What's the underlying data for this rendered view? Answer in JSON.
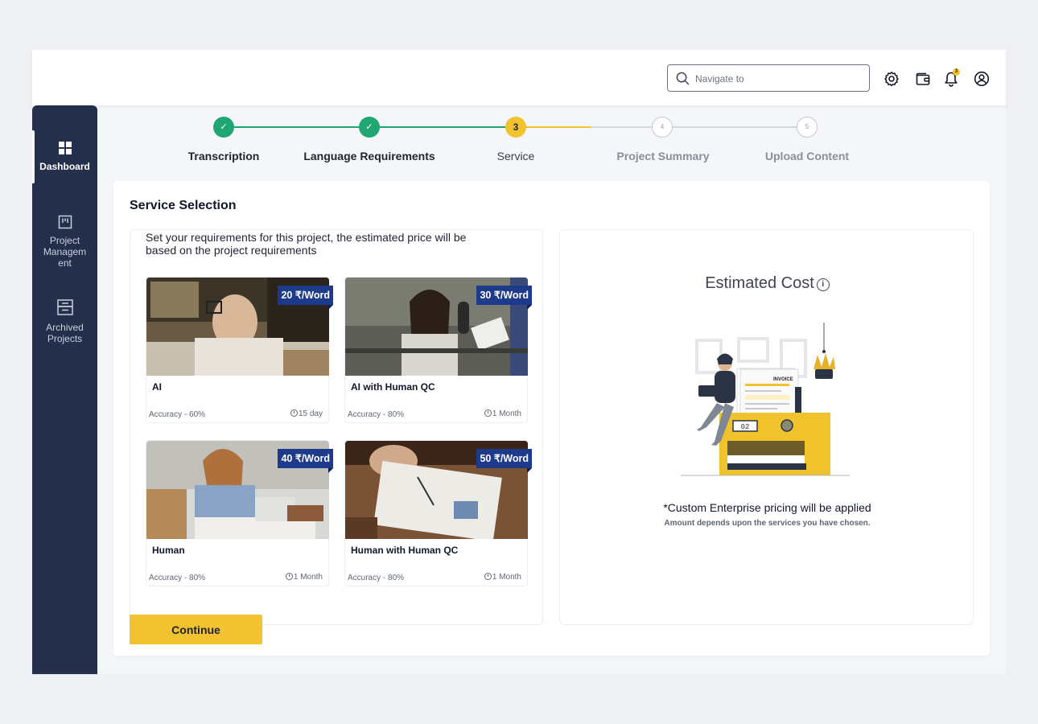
{
  "header": {
    "search_placeholder": "Navigate to",
    "notification_count": "3",
    "icons": [
      "search-icon",
      "gear-icon",
      "wallet-icon",
      "bell-icon",
      "user-circle-icon"
    ]
  },
  "sidebar": {
    "items": [
      {
        "label": "Dashboard",
        "icon": "grid-icon",
        "active": true
      },
      {
        "label": "Project Managem ent",
        "icon": "board-icon",
        "active": false
      },
      {
        "label": "Archived Projects",
        "icon": "archive-icon",
        "active": false
      }
    ]
  },
  "stepper": {
    "steps": [
      {
        "number": "✓",
        "label": "Transcription",
        "state": "done"
      },
      {
        "number": "✓",
        "label": "Language Requirements",
        "state": "done"
      },
      {
        "number": "3",
        "label": "Service",
        "state": "current"
      },
      {
        "number": "4",
        "label": "Project Summary",
        "state": "todo"
      },
      {
        "number": "5",
        "label": "Upload Content",
        "state": "todo"
      }
    ]
  },
  "service_selection": {
    "title": "Service Selection",
    "requirements_text": "Set your requirements for this project, the estimated price will be based on the project requirements",
    "services": [
      {
        "name": "AI",
        "price": "20 ₹/Word",
        "accuracy": "Accuracy - 60%",
        "duration": "15 day"
      },
      {
        "name": "AI  with Human QC",
        "price": "30 ₹/Word",
        "accuracy": "Accuracy - 80%",
        "duration": "1 Month"
      },
      {
        "name": "Human",
        "price": "40 ₹/Word",
        "accuracy": "Accuracy - 80%",
        "duration": "1 Month"
      },
      {
        "name": "Human with Human QC",
        "price": "50 ₹/Word",
        "accuracy": "Accuracy - 80%",
        "duration": "1 Month"
      }
    ],
    "continue_label": "Continue"
  },
  "estimate": {
    "title": "Estimated Cost",
    "invoice_label": "INVOICE",
    "counter_value": "02",
    "custom_text": "*Custom Enterprise pricing will be applied",
    "amount_text": "Amount depends upon the services you have chosen."
  },
  "colors": {
    "sidebar_bg": "#232f4b",
    "accent_yellow": "#f2c230",
    "done_green": "#1fa672",
    "price_tag_blue": "#1e3a8a"
  }
}
